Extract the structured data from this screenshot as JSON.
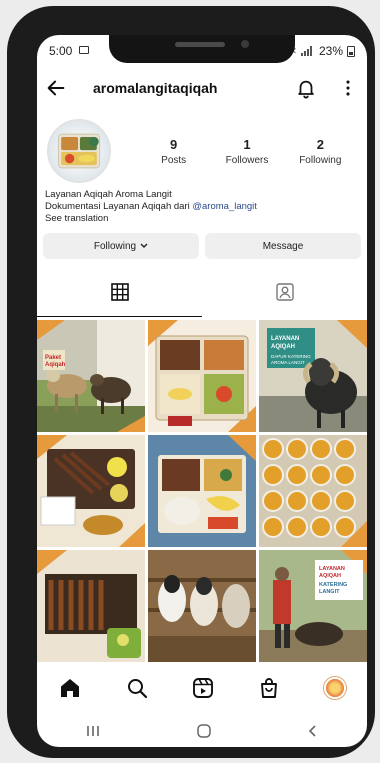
{
  "status_bar": {
    "time": "5:00",
    "battery": "23%"
  },
  "profile": {
    "username": "aromalangitaqiqah",
    "stats": [
      {
        "value": "9",
        "label": "Posts"
      },
      {
        "value": "1",
        "label": "Followers"
      },
      {
        "value": "2",
        "label": "Following"
      }
    ],
    "bio_name": "Layanan Aqiqah Aroma Langit",
    "bio_text": "Dokumentasi Layanan Aqiqah dari ",
    "bio_handle": "@aroma_langit",
    "see_translation": "See translation"
  },
  "buttons": {
    "following": "Following",
    "message": "Message"
  },
  "icons": {
    "back": "back-arrow-icon",
    "notifications": "bell-icon",
    "more": "more-options-icon",
    "grid_tab": "grid-icon",
    "tagged_tab": "tagged-person-icon",
    "home": "home-icon",
    "search": "search-icon",
    "reels": "reels-icon",
    "shop": "shop-bag-icon"
  },
  "grid_posts": [
    {
      "label_lines": [
        "Paket",
        "Aqiqah"
      ],
      "theme": "goats"
    },
    {
      "label_lines": [],
      "theme": "food-tray"
    },
    {
      "label_lines": [
        "LAYANAN",
        "AQIQAH",
        "DAPUR KATERING",
        "AROMA LANGIT"
      ],
      "theme": "ram"
    },
    {
      "label_lines": [],
      "theme": "satay-platter"
    },
    {
      "label_lines": [],
      "theme": "food-box"
    },
    {
      "label_lines": [],
      "theme": "soup-bowls"
    },
    {
      "label_lines": [],
      "theme": "satay"
    },
    {
      "label_lines": [],
      "theme": "goat-pen"
    },
    {
      "label_lines": [
        "LAYANAN",
        "AQIQAH",
        "KATERING",
        "LANGIT"
      ],
      "theme": "goat-handler"
    }
  ],
  "colors": {
    "accent_orange": "#e79a3b",
    "link": "#2a4a8a"
  }
}
